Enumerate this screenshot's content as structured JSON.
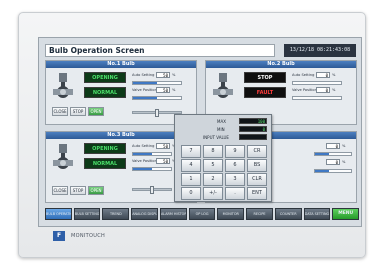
{
  "header": {
    "title": "Bulb Operation Screen",
    "clock": "13/12/18 08:21:43:08"
  },
  "bulb1": {
    "heading": "No.1 Bulb",
    "status1": "OPENING",
    "status2": "NORMAL",
    "label_a": "Auto Setting",
    "value_a": "50",
    "unit_a": "%",
    "label_b": "Valve Position",
    "value_b": "50",
    "unit_b": "%",
    "btn_close": "CLOSE",
    "btn_stop": "STOP",
    "btn_open": "OPEN",
    "level_a": 0.5,
    "level_b": 0.5
  },
  "bulb2": {
    "heading": "No.2 Bulb",
    "status1": "STOP",
    "status2": "FAULT",
    "label_a": "Auto Setting",
    "value_a": "0",
    "unit_a": "%",
    "label_b": "Valve Position",
    "value_b": "0",
    "unit_b": "%",
    "level_a": 0.0,
    "level_b": 0.0
  },
  "bulb3": {
    "heading": "No.3 Bulb",
    "status1": "OPENING",
    "status2": "NORMAL",
    "label_a": "Auto Setting",
    "value_a": "50",
    "unit_a": "%",
    "label_b": "Valve Position",
    "value_b": "50",
    "unit_b": "%",
    "btn_close": "CLOSE",
    "btn_stop": "STOP",
    "btn_open": "OPEN",
    "level_a": 0.5,
    "level_b": 0.5
  },
  "bulb4": {
    "value_a": "0",
    "unit_a": "%",
    "value_b": "0",
    "unit_b": "%"
  },
  "keypad": {
    "max_label": "MAX",
    "min_label": "MIN",
    "input_label": "INPUT VALUE",
    "max_value": "100",
    "min_value": "0",
    "input_value": "",
    "keys": [
      "7",
      "8",
      "9",
      "CR",
      "4",
      "5",
      "6",
      "BS",
      "1",
      "2",
      "3",
      "CLR",
      "0",
      "+/-",
      ".",
      "ENT"
    ]
  },
  "nav": {
    "items": [
      "BULB OPERATION",
      "BULB SETTING",
      "TREND",
      "ANALOG DISPLAY",
      "ALARM HISTORY",
      "OP LOG",
      "MONITOR",
      "RECIPE",
      "COUNTER",
      "DATA SETTING",
      "MENU"
    ]
  },
  "brand": {
    "name": "MONITOUCH",
    "mark": "F"
  },
  "colors": {
    "panel_header": "#2d5a96",
    "status_green": "#4be06a",
    "status_red": "#ff3b3b",
    "menu_green": "#269b2a"
  }
}
